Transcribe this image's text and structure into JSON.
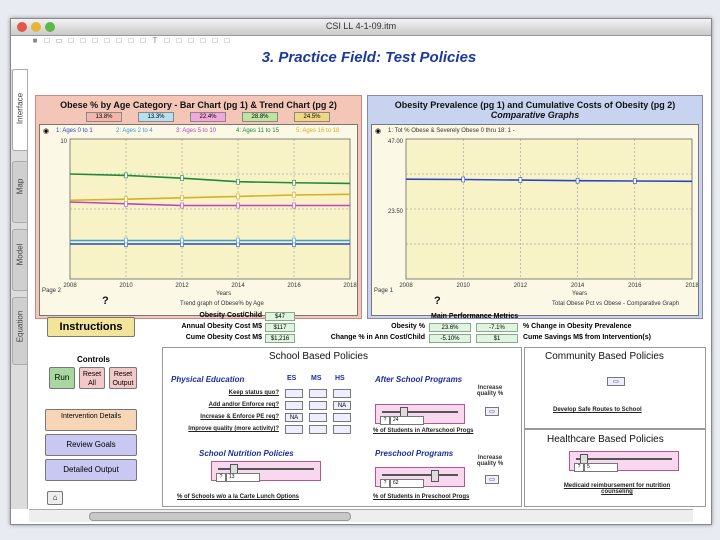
{
  "window": {
    "title": "CSI LL 4-1-09.itm"
  },
  "toolbar": {
    "glyphs": [
      "■",
      "□",
      "▭",
      "□",
      "□",
      "□",
      "□",
      "□",
      "□",
      "□",
      "T",
      "□",
      "□",
      "□",
      "□",
      "□",
      "□"
    ]
  },
  "side_tabs": [
    "Interface",
    "Map",
    "Model",
    "Equation"
  ],
  "page": {
    "title": "3. Practice Field: Test Policies"
  },
  "left_panel": {
    "title": "Obese % by Age Category - Bar Chart (pg 1) & Trend Chart (pg 2)",
    "value_badges": [
      "13.8%",
      "13.3%",
      "22.4%",
      "28.8%",
      "24.5%"
    ],
    "legend": [
      "1: Ages 0 to 1",
      "2: Ages 2 to 4",
      "3: Ages 5 to 10",
      "4: Ages 11 to 15",
      "5: Ages 16 to 18"
    ],
    "page_label": "Page 2",
    "x_title": "Years",
    "footer": "Trend graph of Obese% by Age",
    "qmark": "?"
  },
  "right_panel": {
    "title": "Obesity Prevalence (pg 1) and Cumulative Costs of Obesity (pg 2)",
    "subtitle": "Comparative Graphs",
    "legend": "1: Tot % Obese & Severely Obese 0 thru 18: 1 -",
    "page_label": "Page 1",
    "x_title": "Years",
    "footer": "Total Obese Pct vs Obese - Comparative Graph",
    "qmark": "?"
  },
  "chart_data": [
    {
      "type": "line",
      "x": [
        2008,
        2010,
        2012,
        2014,
        2016,
        2018
      ],
      "xticks": [
        "2008",
        "2010",
        "2012",
        "2014",
        "2016",
        "2018"
      ],
      "xlim": [
        2008,
        2018
      ],
      "ylim": [
        0,
        40
      ],
      "yticks": [
        "10",
        "",
        "",
        "",
        ""
      ],
      "xlabel": "Years",
      "series": [
        {
          "name": "1: Ages 0 to 1",
          "color": "#2a46c8",
          "values": [
            10,
            10,
            10,
            10,
            10,
            10
          ]
        },
        {
          "name": "2: Ages 2 to 4",
          "color": "#3aa0d0",
          "values": [
            11,
            11,
            11,
            11,
            11,
            11
          ]
        },
        {
          "name": "3: Ages 5 to 10",
          "color": "#c040c0",
          "values": [
            22,
            21.5,
            21,
            21,
            21,
            21
          ]
        },
        {
          "name": "4: Ages 11 to 15",
          "color": "#1f8a3a",
          "values": [
            30,
            29.6,
            28.8,
            27.8,
            27.5,
            27.3
          ]
        },
        {
          "name": "5: Ages 16 to 18",
          "color": "#d8b020",
          "values": [
            22.5,
            22.8,
            23.2,
            23.6,
            24,
            24.2
          ]
        }
      ]
    },
    {
      "type": "line",
      "x": [
        2008,
        2010,
        2012,
        2014,
        2016,
        2018
      ],
      "xticks": [
        "2008",
        "2010",
        "2012",
        "2014",
        "2016",
        "2018"
      ],
      "xlim": [
        2008,
        2018
      ],
      "ylim": [
        0,
        47
      ],
      "yticks": [
        "47.00",
        "23.50"
      ],
      "xlabel": "Years",
      "series": [
        {
          "name": "1: Tot % Obese & Severely Obese 0 thru 18",
          "color": "#2a46c8",
          "values": [
            33.5,
            33.4,
            33.2,
            33.0,
            32.9,
            32.8
          ]
        }
      ]
    }
  ],
  "instructions": {
    "label": "Instructions"
  },
  "costs": {
    "rows": [
      {
        "label": "Obesity Cost/Child",
        "value": "$47"
      },
      {
        "label": "Annual Obesity Cost M$",
        "value": "$117"
      },
      {
        "label": "Cume Obesity Cost M$",
        "value": "$1,216"
      }
    ]
  },
  "metrics": {
    "title": "Main Performance Metrics",
    "rows": [
      {
        "label": "Obesity %",
        "value": "23.6%",
        "value2": "-7.1%",
        "right": "% Change in Obesity Prevalence"
      },
      {
        "label": "Change % in Ann Cost/Child",
        "value": "-5.10%",
        "value2": "$1",
        "right": "Cume Savings M$ from Intervention(s)"
      }
    ]
  },
  "controls": {
    "title": "Controls",
    "run": "Run",
    "reset_all": "Reset All",
    "reset_output": "Reset Output",
    "intervention": "Intervention Details",
    "review": "Review Goals",
    "detailed": "Detailed Output"
  },
  "school": {
    "title": "School Based Policies",
    "pe": {
      "title": "Physical Education",
      "cols": [
        "ES",
        "MS",
        "HS"
      ],
      "rows": [
        {
          "label": "Keep status quo?",
          "vals": [
            "",
            "",
            ""
          ]
        },
        {
          "label": "Add and/or Enforce req?",
          "vals": [
            "",
            "",
            "NA"
          ]
        },
        {
          "label": "Increase & Enforce PE req?",
          "vals": [
            "NA",
            "",
            ""
          ]
        },
        {
          "label": "Improve quality (more activity)?",
          "vals": [
            "",
            "",
            ""
          ]
        }
      ]
    },
    "after": {
      "title": "After School Programs",
      "increase": "Increase quality %",
      "value": "24",
      "label": "% of Students in Afterschool Progs"
    },
    "nutrition": {
      "title": "School Nutrition Policies",
      "value": "13",
      "label": "% of Schools w/o a la Carte Lunch Options"
    },
    "preschool": {
      "title": "Preschool Programs",
      "increase": "Increase quality %",
      "value": "62",
      "label": "% of Students in Preschool Progs"
    }
  },
  "community": {
    "title": "Community Based Policies",
    "route": "Develop Safe Routes to School"
  },
  "healthcare": {
    "title": "Healthcare Based Policies",
    "value": "5",
    "label": "Medicaid reimbursement for nutrition counseling"
  },
  "colors": {
    "left_panel": "#f3c6b8",
    "right_panel": "#c8d3f0",
    "chart_bg": "#f7f3c6"
  }
}
